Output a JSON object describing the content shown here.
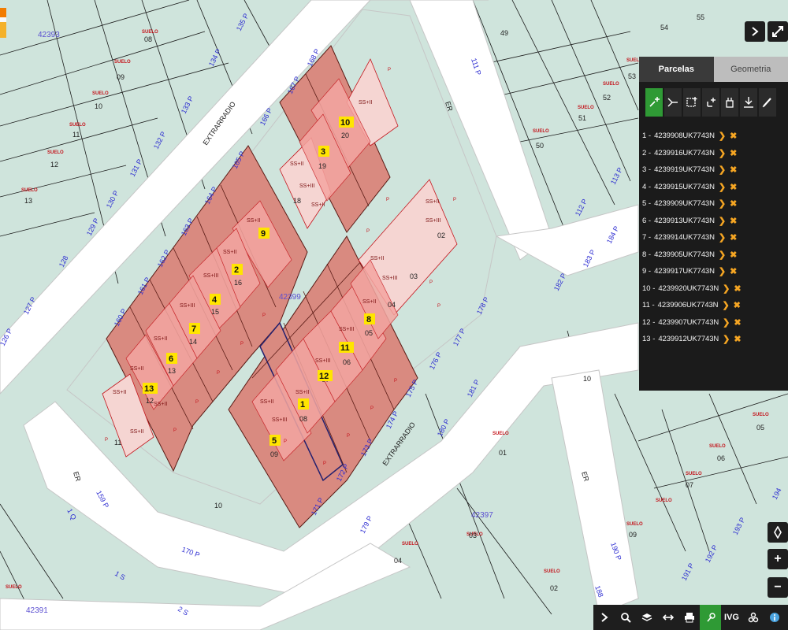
{
  "panel": {
    "tabs": [
      {
        "label": "Parcelas",
        "active": true
      },
      {
        "label": "Geometria",
        "active": false
      }
    ],
    "tool_icons": [
      "add-parcel-icon",
      "split-icon",
      "select-area-icon",
      "add-point-icon",
      "sequence-icon",
      "download-icon",
      "edit-icon"
    ],
    "parcels": [
      {
        "index": "1 -",
        "code": "4239908UK7743N"
      },
      {
        "index": "2 -",
        "code": "4239916UK7743N"
      },
      {
        "index": "3 -",
        "code": "4239919UK7743N"
      },
      {
        "index": "4 -",
        "code": "4239915UK7743N"
      },
      {
        "index": "5 -",
        "code": "4239909UK7743N"
      },
      {
        "index": "6 -",
        "code": "4239913UK7743N"
      },
      {
        "index": "7 -",
        "code": "4239914UK7743N"
      },
      {
        "index": "8 -",
        "code": "4239905UK7743N"
      },
      {
        "index": "9 -",
        "code": "4239917UK7743N"
      },
      {
        "index": "10 -",
        "code": "4239920UK7743N"
      },
      {
        "index": "11 -",
        "code": "4239906UK7743N"
      },
      {
        "index": "12 -",
        "code": "4239907UK7743N"
      },
      {
        "index": "13 -",
        "code": "4239912UK7743N"
      }
    ]
  },
  "map": {
    "block_ids": [
      "42393",
      "42399",
      "42397",
      "42391"
    ],
    "streets": [
      "EXTRARRADIO",
      "EXTRARRADIO",
      "ER",
      "ER",
      "ER"
    ],
    "suelo": "SUELO",
    "p": "P",
    "ss_labels": [
      "SS+II",
      "SS+III"
    ],
    "selected_labels": [
      "1",
      "2",
      "3",
      "4",
      "5",
      "6",
      "7",
      "8",
      "9",
      "10",
      "11",
      "12",
      "13"
    ],
    "left_parcels": [
      "08",
      "09",
      "10",
      "11",
      "12",
      "13"
    ],
    "right_parcels": [
      "55",
      "49",
      "54",
      "53",
      "52",
      "51",
      "50"
    ],
    "block_parcels": [
      "20",
      "19",
      "18",
      "16",
      "15",
      "14",
      "13",
      "12",
      "11",
      "02",
      "03",
      "04",
      "05",
      "06",
      "07",
      "08",
      "09",
      "10"
    ],
    "lower_parcels": [
      "01",
      "02",
      "03",
      "04",
      "05",
      "06",
      "07",
      "09",
      "10"
    ],
    "road_numbers_top": [
      "126 P",
      "127 P",
      "128",
      "129 P",
      "130 P",
      "131 P",
      "132 P",
      "133 P",
      "134 P",
      "135 P"
    ],
    "road_numbers_block_top": [
      "160 P",
      "161 P",
      "162 P",
      "163 P",
      "164 P",
      "165 P",
      "166 P",
      "167 P",
      "168 P"
    ],
    "road_numbers_bottom": [
      "171 P",
      "172 P",
      "173 P",
      "174 P",
      "175 P",
      "176 P",
      "177 P",
      "178 P"
    ],
    "road_numbers_right": [
      "111 P",
      "113 P",
      "112 P",
      "182 P",
      "183 P",
      "184 P",
      "181 P",
      "180 P",
      "179 P"
    ],
    "road_numbers_misc": [
      "159 P",
      "170 P",
      "1 Q",
      "1 S",
      "2 S",
      "190 P",
      "191 P",
      "192 P",
      "193 P",
      "194",
      "188"
    ]
  },
  "controls": {
    "collapse_icon": "chevron-right-icon",
    "expand_icon": "expand-icon",
    "locate_icon": "locate-icon",
    "zoom_in": "+",
    "zoom_out": "−"
  },
  "bottombar": {
    "items": [
      "chevron-right-icon",
      "search-icon",
      "layers-icon",
      "measure-icon",
      "print-icon",
      "parcel-tool-icon",
      "IVG",
      "group-icon",
      "info-icon"
    ],
    "ivg_label": "IVG"
  }
}
